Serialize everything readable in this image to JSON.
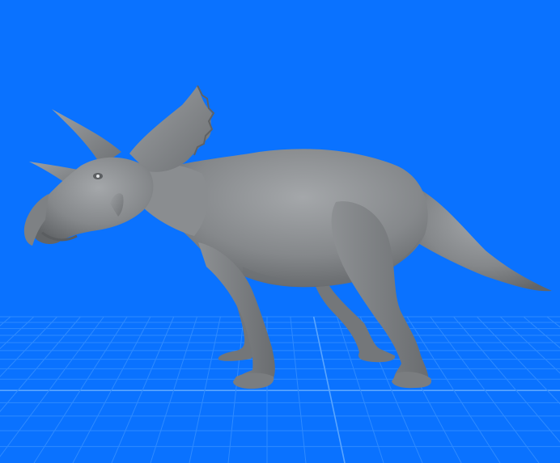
{
  "scene": {
    "background_color": "#0a72ff",
    "grid_line_color": "#2f8bff",
    "grid_major_line_color": "#5aa6ff",
    "model_color": "#8a8d90",
    "model_shadow_color": "#5f6265",
    "model_highlight_color": "#b3b6b9",
    "model_subject": "triceratops-dinosaur-3d-model"
  }
}
